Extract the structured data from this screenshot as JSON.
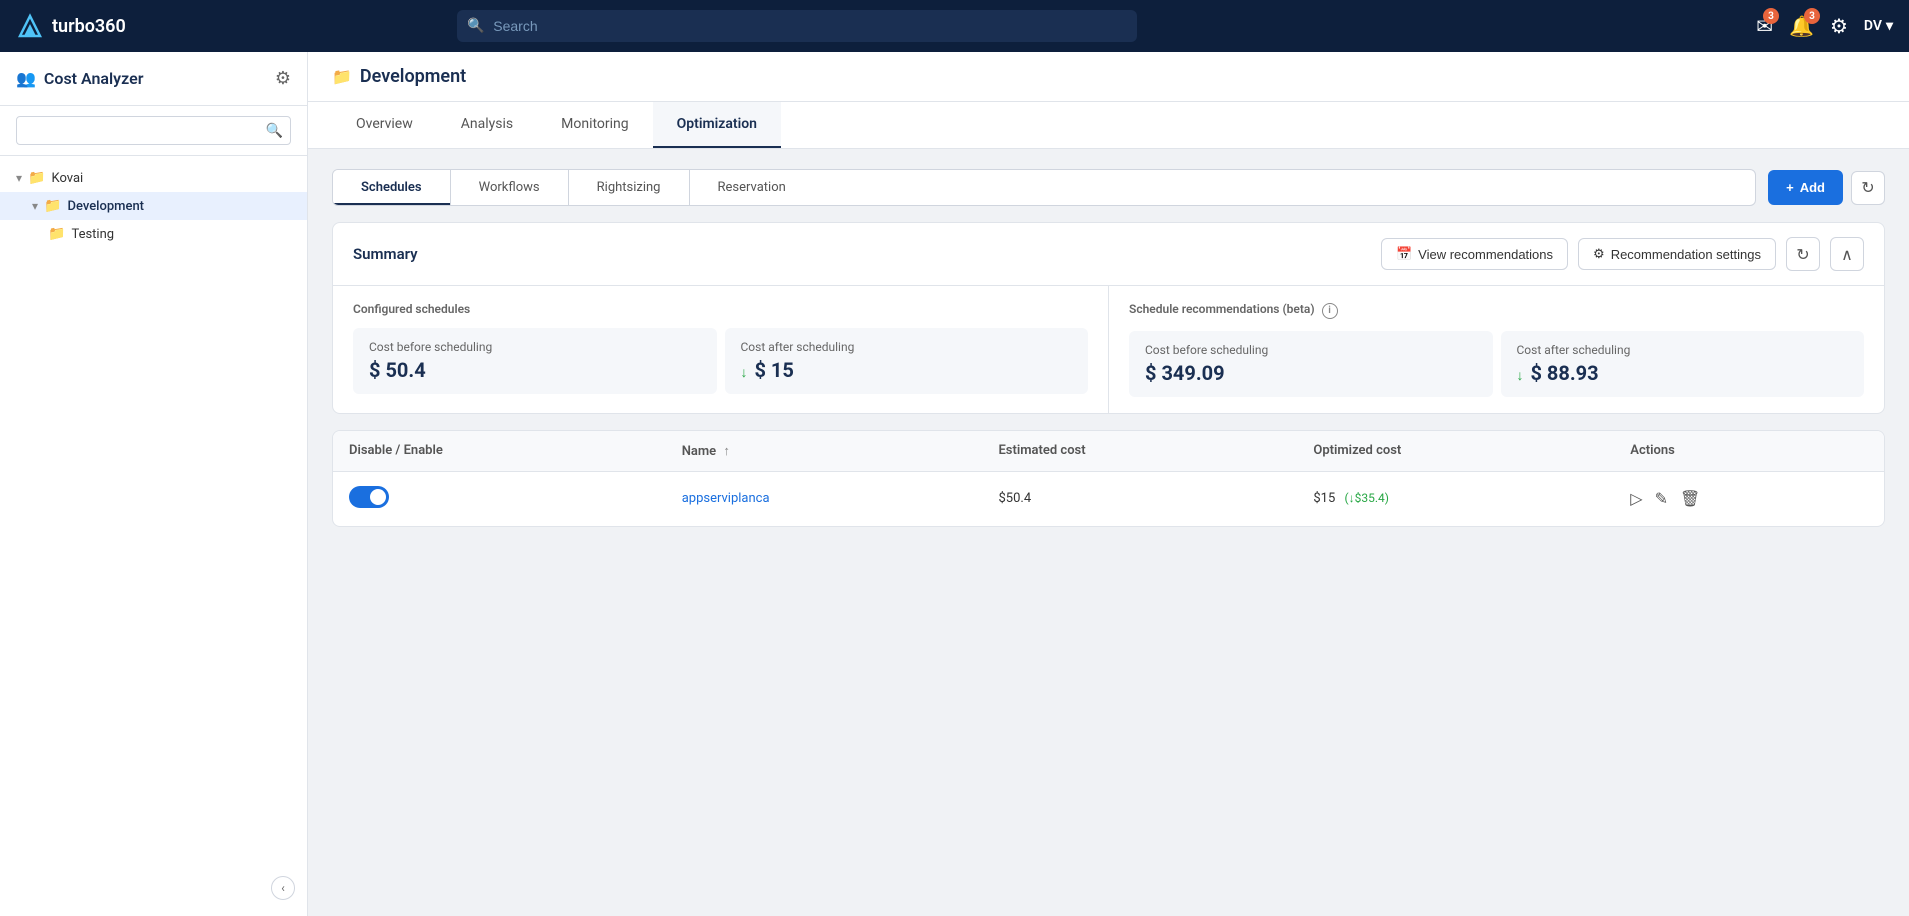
{
  "topnav": {
    "brand": "turbo360",
    "search_placeholder": "Search",
    "badge_messages": "3",
    "badge_alerts": "3",
    "user_initials": "DV"
  },
  "sidebar": {
    "title": "Cost Analyzer",
    "search_placeholder": "",
    "tree": [
      {
        "id": "kovai",
        "label": "Kovai",
        "level": 0,
        "expanded": true,
        "type": "folder"
      },
      {
        "id": "development",
        "label": "Development",
        "level": 1,
        "expanded": true,
        "active": true,
        "type": "folder"
      },
      {
        "id": "testing",
        "label": "Testing",
        "level": 2,
        "active": false,
        "type": "folder"
      }
    ],
    "collapse_tooltip": "Collapse sidebar"
  },
  "page": {
    "title": "Development",
    "tabs": [
      {
        "id": "overview",
        "label": "Overview"
      },
      {
        "id": "analysis",
        "label": "Analysis"
      },
      {
        "id": "monitoring",
        "label": "Monitoring"
      },
      {
        "id": "optimization",
        "label": "Optimization",
        "active": true
      }
    ],
    "subtabs": [
      {
        "id": "schedules",
        "label": "Schedules",
        "active": true
      },
      {
        "id": "workflows",
        "label": "Workflows"
      },
      {
        "id": "rightsizing",
        "label": "Rightsizing"
      },
      {
        "id": "reservation",
        "label": "Reservation"
      }
    ],
    "add_button": "+ Add"
  },
  "summary": {
    "title": "Summary",
    "view_recommendations_label": "View recommendations",
    "recommendation_settings_label": "Recommendation settings",
    "configured_schedules": {
      "section_title": "Configured schedules",
      "cost_before_label": "Cost before scheduling",
      "cost_before_value": "$ 50.4",
      "cost_after_label": "Cost after scheduling",
      "cost_after_arrow": "↓",
      "cost_after_value": "$ 15"
    },
    "recommendations": {
      "section_title": "Schedule recommendations (beta)",
      "cost_before_label": "Cost before scheduling",
      "cost_before_value": "$ 349.09",
      "cost_after_label": "Cost after scheduling",
      "cost_after_arrow": "↓",
      "cost_after_value": "$ 88.93"
    }
  },
  "table": {
    "columns": [
      {
        "id": "disable_enable",
        "label": "Disable / Enable"
      },
      {
        "id": "name",
        "label": "Name",
        "sort": "asc"
      },
      {
        "id": "estimated_cost",
        "label": "Estimated cost"
      },
      {
        "id": "optimized_cost",
        "label": "Optimized cost"
      },
      {
        "id": "actions",
        "label": "Actions"
      }
    ],
    "rows": [
      {
        "enabled": true,
        "name": "appserviplanca",
        "estimated_cost": "$50.4",
        "optimized_cost": "$15",
        "savings": "↓$35.4"
      }
    ]
  }
}
